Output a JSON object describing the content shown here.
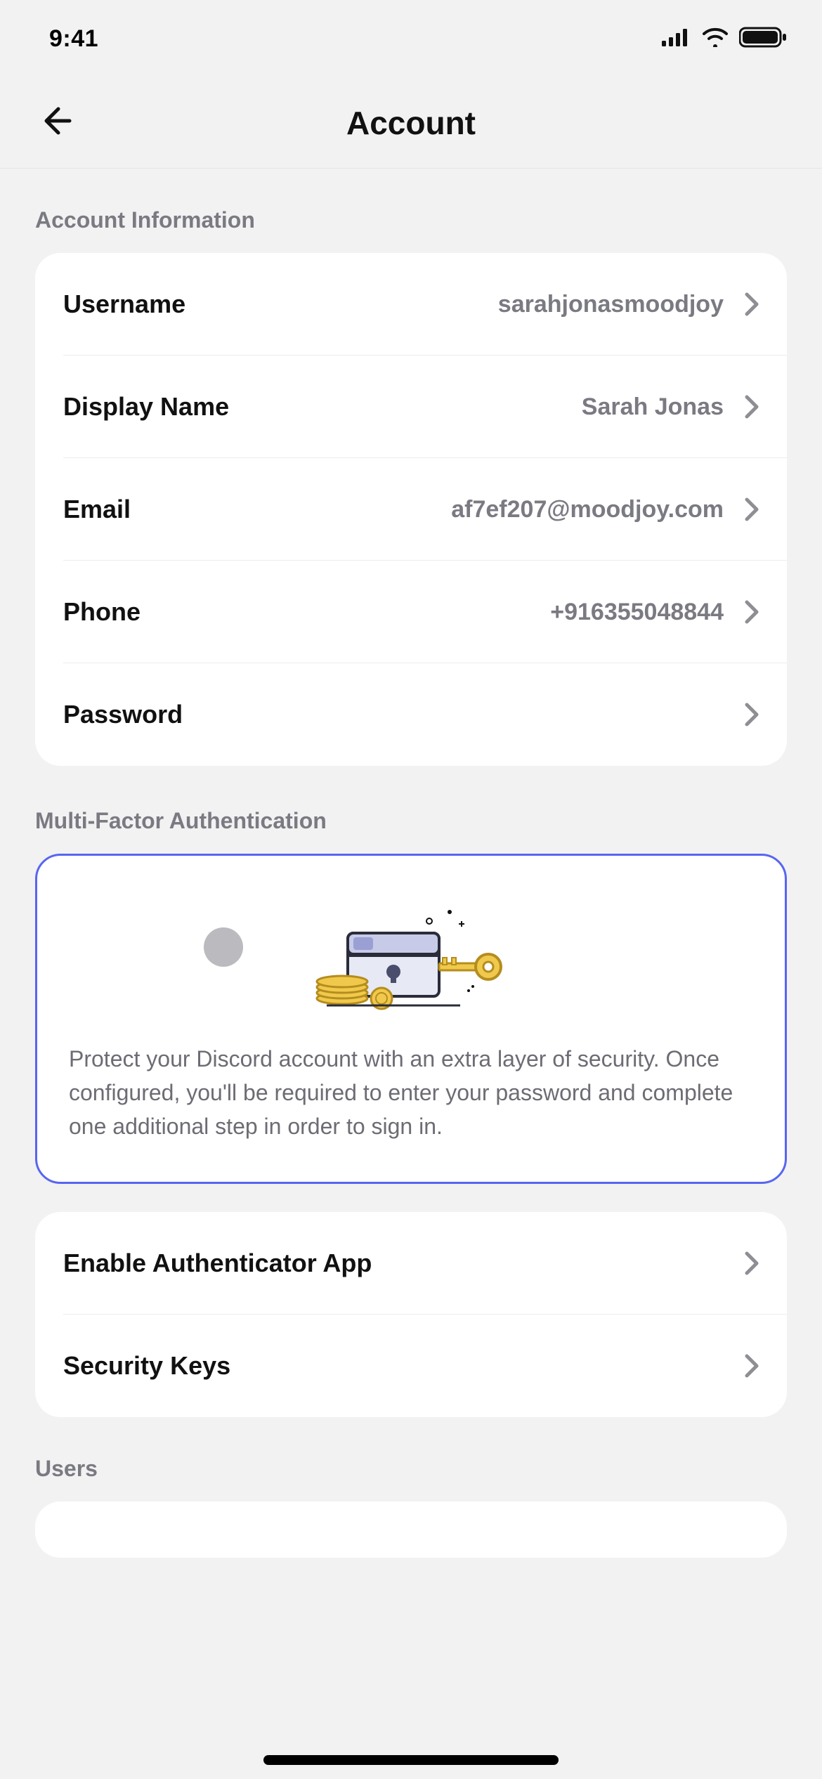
{
  "status": {
    "time": "9:41"
  },
  "header": {
    "title": "Account"
  },
  "sections": {
    "account_info": {
      "title": "Account Information",
      "rows": {
        "username": {
          "label": "Username",
          "value": "sarahjonasmoodjoy"
        },
        "display_name": {
          "label": "Display Name",
          "value": "Sarah Jonas"
        },
        "email": {
          "label": "Email",
          "value": "af7ef207@moodjoy.com"
        },
        "phone": {
          "label": "Phone",
          "value": "+916355048844"
        },
        "password": {
          "label": "Password",
          "value": ""
        }
      }
    },
    "mfa": {
      "title": "Multi-Factor Authentication",
      "info_text": "Protect your Discord account with an extra layer of security. Once configured, you'll be required to enter your password and complete one additional step in order to sign in.",
      "rows": {
        "authenticator": {
          "label": "Enable Authenticator App"
        },
        "security_keys": {
          "label": "Security Keys"
        }
      }
    },
    "users": {
      "title": "Users"
    }
  }
}
